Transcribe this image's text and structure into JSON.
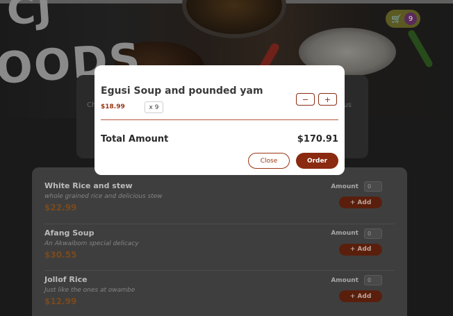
{
  "header": {
    "logo_top": "CJ",
    "logo_bottom": "OODS",
    "cart_icon": "cart-icon",
    "cart_count": "9"
  },
  "summary": {
    "left_text": "Ch",
    "right_text": "us"
  },
  "meals": [
    {
      "name": "White Rice and stew",
      "description": "whole grained rice and delicious stew",
      "price": "$22.99",
      "amount_label": "Amount",
      "amount_value": "0",
      "add_label": "+ Add"
    },
    {
      "name": "Afang Soup",
      "description": "An Akwaibom special delicacy",
      "price": "$30.55",
      "amount_label": "Amount",
      "amount_value": "0",
      "add_label": "+ Add"
    },
    {
      "name": "Jollof Rice",
      "description": "Just like the ones at owambe",
      "price": "$12.99",
      "amount_label": "Amount",
      "amount_value": "0",
      "add_label": "+ Add"
    }
  ],
  "modal": {
    "item_name": "Egusi Soup and pounded yam",
    "item_price": "$18.99",
    "item_qty": "x 9",
    "minus_label": "−",
    "plus_label": "+",
    "total_label": "Total Amount",
    "total_value": "$170.91",
    "close_label": "Close",
    "order_label": "Order"
  },
  "colors": {
    "accent": "#8a2a10",
    "price": "#9a3412",
    "overlay": "#1a1a1a"
  }
}
